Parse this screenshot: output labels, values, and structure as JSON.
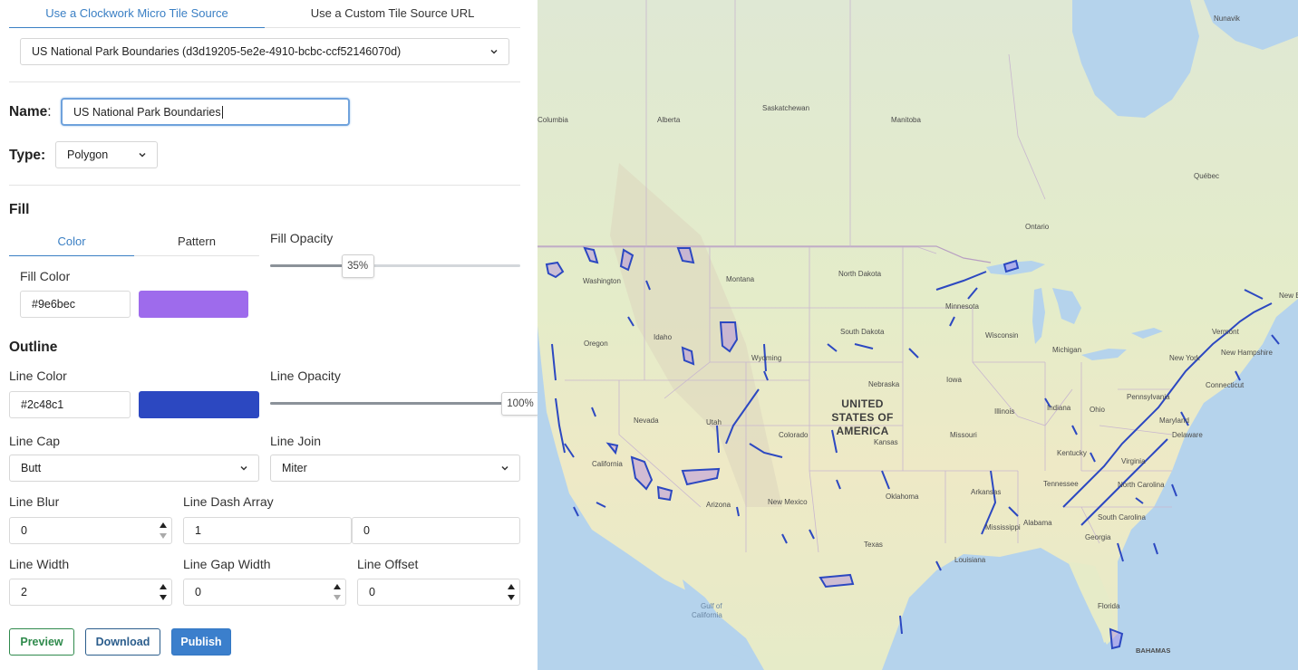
{
  "tabs": {
    "clockwork": "Use a Clockwork Micro Tile Source",
    "custom": "Use a Custom Tile Source URL"
  },
  "source_select": {
    "value": "US National Park Boundaries (d3d19205-5e2e-4910-bcbc-ccf52146070d)"
  },
  "name": {
    "label": "Name",
    "colon": ":",
    "value": "US National Park Boundaries"
  },
  "type": {
    "label": "Type:",
    "value": "Polygon"
  },
  "fill": {
    "title": "Fill",
    "tab_color": "Color",
    "tab_pattern": "Pattern",
    "color_label": "Fill Color",
    "color_value": "#9e6bec",
    "swatch_color": "#9e6bec",
    "opacity_label": "Fill Opacity",
    "opacity_value": "35%",
    "opacity_fraction": 0.35
  },
  "outline": {
    "title": "Outline",
    "line_color_label": "Line Color",
    "line_color_value": "#2c48c1",
    "swatch_color": "#2c48c1",
    "line_opacity_label": "Line Opacity",
    "line_opacity_value": "100%",
    "line_opacity_fraction": 1.0,
    "line_cap_label": "Line Cap",
    "line_cap_value": "Butt",
    "line_join_label": "Line Join",
    "line_join_value": "Miter",
    "line_blur_label": "Line Blur",
    "line_blur_value": "0",
    "line_dash_label": "Line Dash Array",
    "line_dash_1": "1",
    "line_dash_2": "0",
    "line_width_label": "Line Width",
    "line_width_value": "2",
    "line_gap_label": "Line Gap Width",
    "line_gap_value": "0",
    "line_offset_label": "Line Offset",
    "line_offset_value": "0"
  },
  "buttons": {
    "preview": "Preview",
    "download": "Download",
    "publish": "Publish"
  },
  "map": {
    "labels": {
      "nunavik": "Nunavik",
      "saskatchewan": "Saskatchewan",
      "manitoba": "Manitoba",
      "alberta": "Alberta",
      "columbia": "Columbia",
      "ontario": "Ontario",
      "quebec": "Québec",
      "washington": "Washington",
      "montana": "Montana",
      "north_dakota": "North Dakota",
      "minnesota": "Minnesota",
      "oregon": "Oregon",
      "idaho": "Idaho",
      "south_dakota": "South Dakota",
      "wisconsin": "Wisconsin",
      "michigan": "Michigan",
      "wyoming": "Wyoming",
      "vermont": "Vermont",
      "new_hampshire": "New Hampshire",
      "new_york": "New York",
      "nebraska": "Nebraska",
      "iowa": "Iowa",
      "connecticut": "Connecticut",
      "pennsylvania": "Pennsylvania",
      "nevada": "Nevada",
      "utah": "Utah",
      "colorado": "Colorado",
      "illinois": "Illinois",
      "indiana": "Indiana",
      "ohio": "Ohio",
      "maryland": "Maryland",
      "delaware": "Delaware",
      "kansas": "Kansas",
      "missouri": "Missouri",
      "kentucky": "Kentucky",
      "virginia": "Virginia",
      "california": "California",
      "tennessee": "Tennessee",
      "north_carolina": "North Carolina",
      "oklahoma": "Oklahoma",
      "arkansas": "Arkansas",
      "new_mexico": "New Mexico",
      "arizona": "Arizona",
      "south_carolina": "South Carolina",
      "mississippi": "Mississippi",
      "alabama": "Alabama",
      "georgia": "Georgia",
      "texas": "Texas",
      "louisiana": "Louisiana",
      "florida": "Florida",
      "bahamas": "BAHAMAS",
      "new_br": "New Br",
      "gulf": "Gulf of",
      "gulf2": "California",
      "usa_1": "UNITED",
      "usa_2": "STATES OF",
      "usa_3": "AMERICA"
    }
  }
}
